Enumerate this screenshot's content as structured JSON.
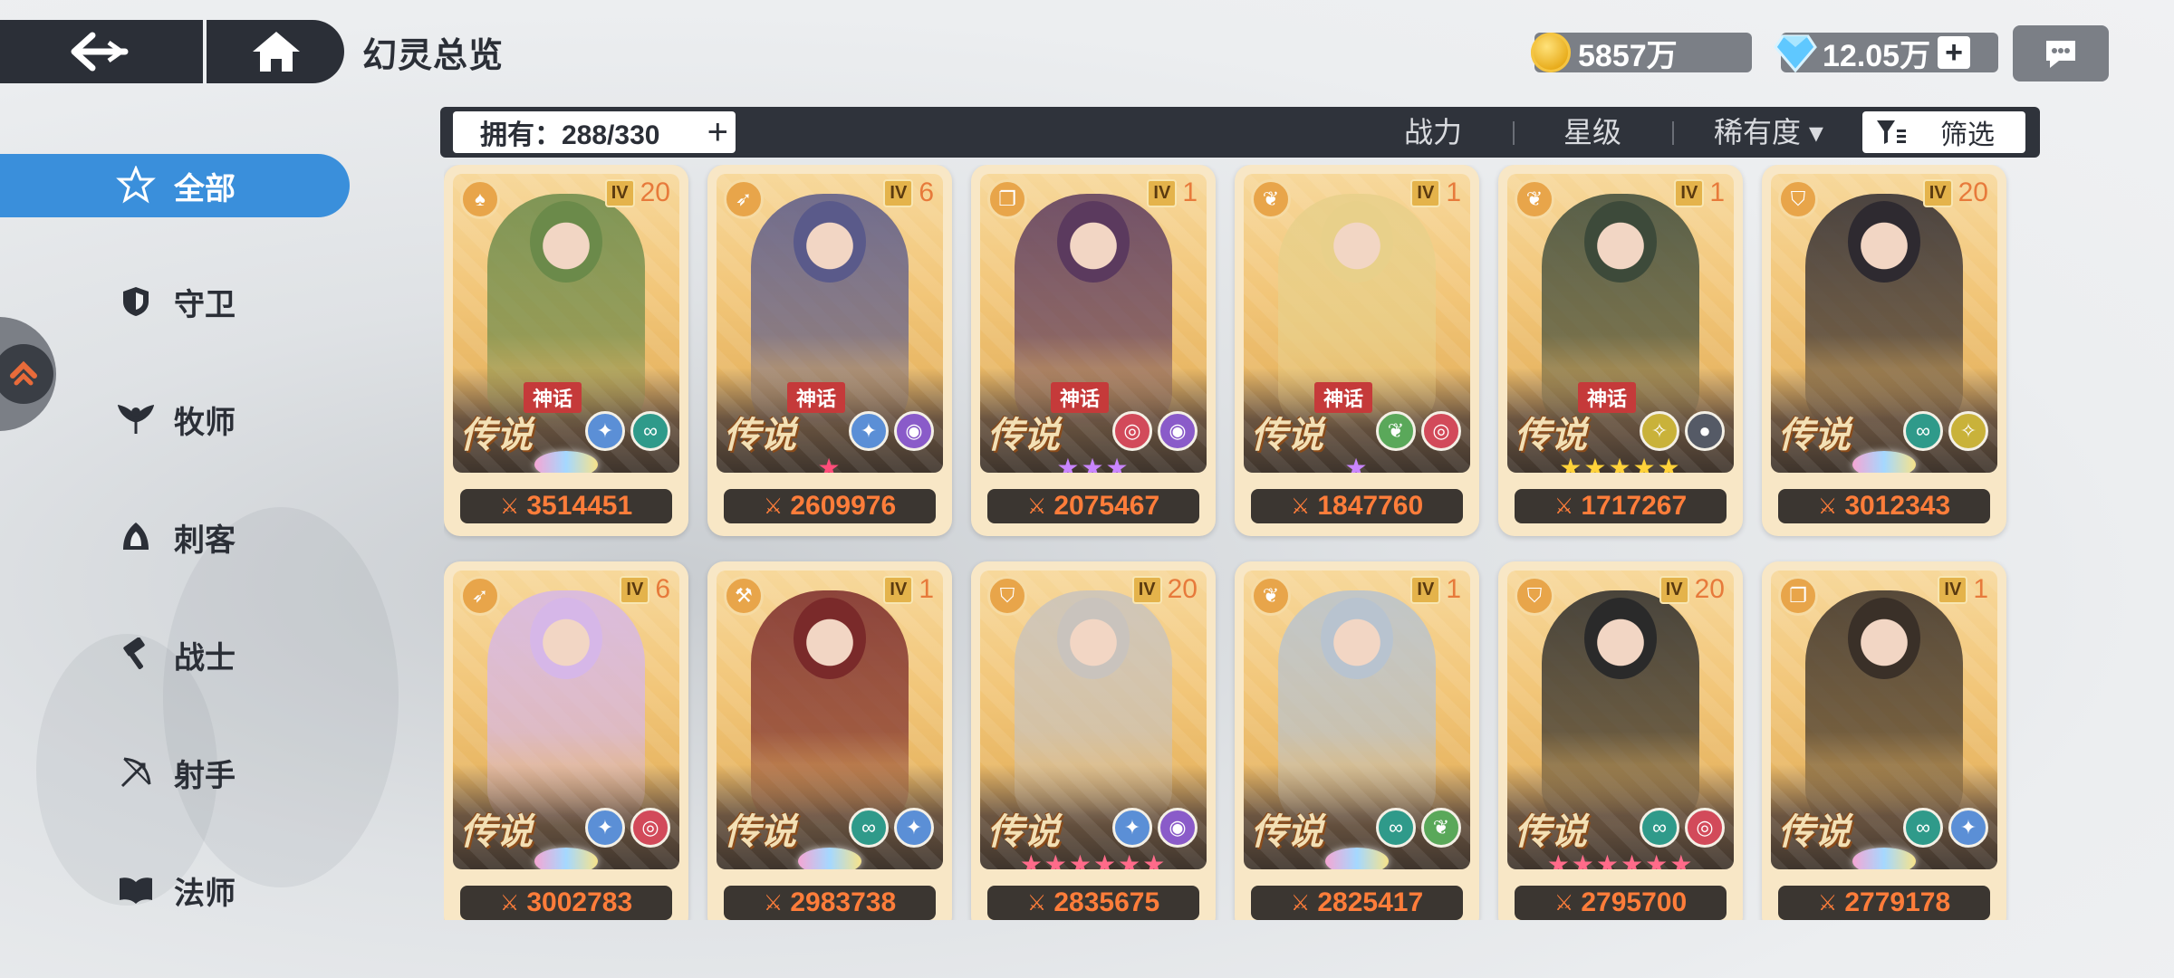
{
  "header": {
    "title": "幻灵总览",
    "gold": "5857万",
    "gems": "12.05万",
    "gems_add": "+"
  },
  "filter_bar": {
    "owned_label": "拥有：288/330",
    "owned_add": "+",
    "sort_power": "战力",
    "sort_star": "星级",
    "sort_rarity": "稀有度 ▾",
    "filter_label": "筛选"
  },
  "sidebar": {
    "items": [
      {
        "label": "全部",
        "icon": "star-hex-icon",
        "active": true
      },
      {
        "label": "守卫",
        "icon": "shield-icon"
      },
      {
        "label": "牧师",
        "icon": "leaf-wings-icon"
      },
      {
        "label": "刺客",
        "icon": "hood-icon"
      },
      {
        "label": "战士",
        "icon": "hammer-icon"
      },
      {
        "label": "射手",
        "icon": "bow-icon"
      },
      {
        "label": "法师",
        "icon": "book-icon"
      }
    ]
  },
  "cards": [
    {
      "class": "assassin",
      "tier_badge": "IV",
      "level": "20",
      "myth": "神话",
      "rarity": "传说",
      "elements": [
        "star",
        "water"
      ],
      "star_display": "crest",
      "stars": "",
      "star_color": "#f3a",
      "power": "3514451",
      "hue": "#6b8a4a"
    },
    {
      "class": "archer",
      "tier_badge": "IV",
      "level": "6",
      "myth": "神话",
      "rarity": "传说",
      "elements": [
        "star",
        "void"
      ],
      "star_display": "stars",
      "stars": "★",
      "star_color": "#ff4d7a",
      "power": "2609976",
      "hue": "#5a5a8a"
    },
    {
      "class": "mage",
      "tier_badge": "IV",
      "level": "1",
      "myth": "神话",
      "rarity": "传说",
      "elements": [
        "fire",
        "void"
      ],
      "star_display": "stars",
      "stars": "★★★",
      "star_color": "#c985ff",
      "power": "2075467",
      "hue": "#5b3a5e"
    },
    {
      "class": "priest",
      "tier_badge": "IV",
      "level": "1",
      "myth": "神话",
      "rarity": "传说",
      "elements": [
        "nature",
        "fire"
      ],
      "star_display": "stars",
      "stars": "★",
      "star_color": "#c985ff",
      "power": "1847760",
      "hue": "#e8d08a"
    },
    {
      "class": "priest",
      "tier_badge": "IV",
      "level": "1",
      "myth": "神话",
      "rarity": "传说",
      "elements": [
        "light",
        "dark"
      ],
      "star_display": "stars",
      "stars": "★★★★★",
      "star_color": "#ffd23a",
      "power": "1717267",
      "hue": "#3d4a3a"
    },
    {
      "class": "guard",
      "tier_badge": "IV",
      "level": "20",
      "myth": "",
      "rarity": "传说",
      "elements": [
        "water",
        "light"
      ],
      "star_display": "crest",
      "stars": "",
      "star_color": "#fff",
      "power": "3012343",
      "hue": "#2e2a30"
    },
    {
      "class": "archer",
      "tier_badge": "IV",
      "level": "6",
      "myth": "",
      "rarity": "传说",
      "elements": [
        "star",
        "fire"
      ],
      "star_display": "crest",
      "stars": "",
      "star_color": "#fff",
      "power": "3002783",
      "hue": "#d6b7e8"
    },
    {
      "class": "warrior",
      "tier_badge": "IV",
      "level": "1",
      "myth": "",
      "rarity": "传说",
      "elements": [
        "water",
        "star"
      ],
      "star_display": "crest",
      "stars": "",
      "star_color": "#fff",
      "power": "2983738",
      "hue": "#7a2a2a"
    },
    {
      "class": "guard",
      "tier_badge": "IV",
      "level": "20",
      "myth": "",
      "rarity": "传说",
      "elements": [
        "star",
        "void"
      ],
      "star_display": "stars",
      "stars": "★★★★★★",
      "star_color": "#ff6b8a",
      "power": "2835675",
      "hue": "#c9c3bd"
    },
    {
      "class": "priest",
      "tier_badge": "IV",
      "level": "1",
      "myth": "",
      "rarity": "传说",
      "elements": [
        "water",
        "nature"
      ],
      "star_display": "crest",
      "stars": "",
      "star_color": "#fff",
      "power": "2825417",
      "hue": "#b8c3cf"
    },
    {
      "class": "guard",
      "tier_badge": "IV",
      "level": "20",
      "myth": "",
      "rarity": "传说",
      "elements": [
        "water",
        "fire"
      ],
      "star_display": "stars",
      "stars": "★★★★★★",
      "star_color": "#ff6b8a",
      "power": "2795700",
      "hue": "#2a2a2a"
    },
    {
      "class": "mage",
      "tier_badge": "IV",
      "level": "1",
      "myth": "",
      "rarity": "传说",
      "elements": [
        "water",
        "star"
      ],
      "star_display": "crest",
      "stars": "",
      "star_color": "#fff",
      "power": "2779178",
      "hue": "#3a3028"
    }
  ]
}
